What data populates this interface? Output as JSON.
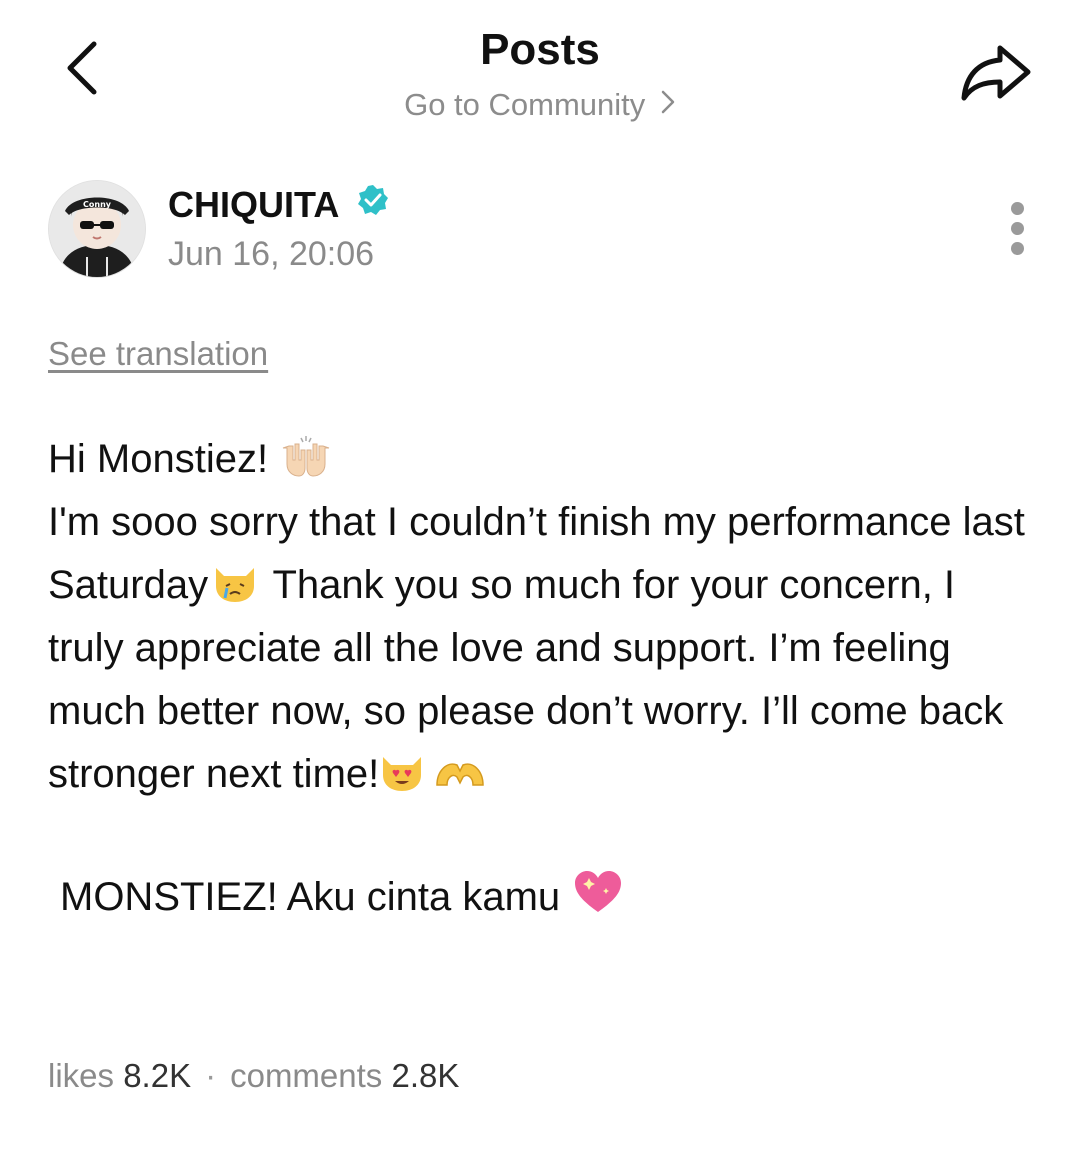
{
  "header": {
    "title": "Posts",
    "subtitle": "Go to Community",
    "icons": {
      "back": "chevron-left-icon",
      "share": "share-arrow-icon"
    }
  },
  "post": {
    "author": "CHIQUITA",
    "verified": true,
    "date": "Jun 16, 20:06",
    "avatar_caption": "Conny",
    "see_translation": "See translation",
    "paragraph_1_a": "Hi Monstiez! ",
    "paragraph_1_b": "I'm sooo sorry that I couldn’t finish my performance last Saturday",
    "paragraph_1_c": " Thank you so much for your concern, I truly appreciate all the love and support. I’m feeling much better now, so please don’t worry. I’ll come back stronger next time!",
    "paragraph_2": "MONSTIEZ! Aku cinta kamu ",
    "emojis": [
      "raising-hands-emoji",
      "crying-cat-emoji",
      "heart-eyes-cat-emoji",
      "heart-hands-emoji",
      "sparkling-heart-emoji"
    ]
  },
  "stats": {
    "likes_label": "likes",
    "likes_value": "8.2K",
    "separator": "·",
    "comments_label": "comments",
    "comments_value": "2.8K"
  },
  "colors": {
    "verified": "#2fc0c8",
    "muted_text": "#8a8a8a",
    "primary_text": "#111111"
  }
}
